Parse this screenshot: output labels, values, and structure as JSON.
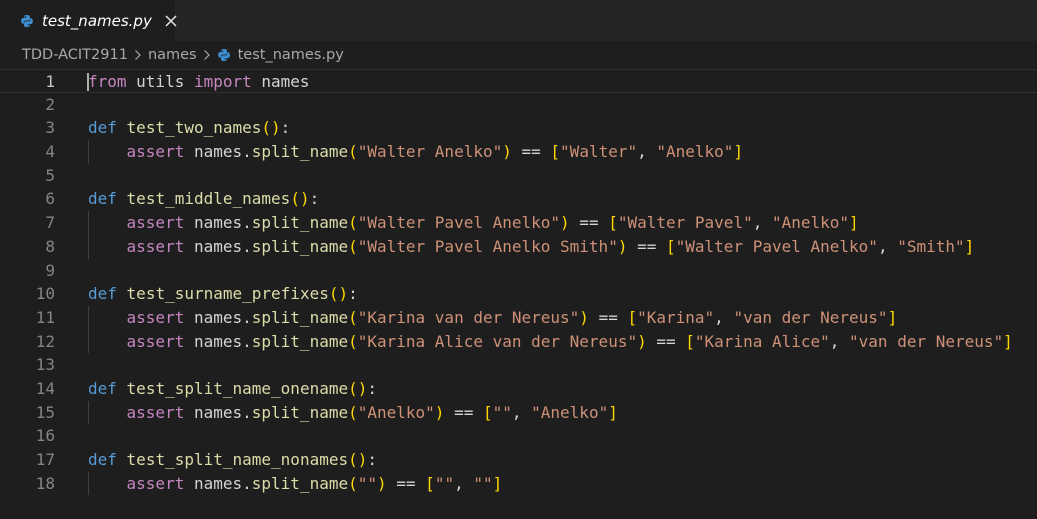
{
  "tab": {
    "title": "test_names.py",
    "close_glyph": "✕"
  },
  "breadcrumb": {
    "items": [
      "TDD-ACIT2911",
      "names",
      "test_names.py"
    ]
  },
  "colors": {
    "background": "#1e1e1e",
    "keyword_control": "#c586c0",
    "keyword_def": "#569cd6",
    "function": "#dcdcaa",
    "string": "#ce9178",
    "bracket_level1": "#ffd700",
    "bracket_level2": "#da70d6",
    "python_icon": "#3f8fd0"
  },
  "editor": {
    "active_line": 1,
    "lines": [
      {
        "num": "1",
        "tokens": [
          [
            "kw",
            "from"
          ],
          [
            "id",
            " utils "
          ],
          [
            "kw",
            "import"
          ],
          [
            "id",
            " names"
          ]
        ]
      },
      {
        "num": "2",
        "tokens": []
      },
      {
        "num": "3",
        "tokens": [
          [
            "def",
            "def"
          ],
          [
            "id",
            " "
          ],
          [
            "fn",
            "test_two_names"
          ],
          [
            "p1",
            "()"
          ],
          [
            "id",
            ":"
          ]
        ]
      },
      {
        "num": "4",
        "tokens": [
          [
            "id",
            "    "
          ],
          [
            "kw",
            "assert"
          ],
          [
            "id",
            " names."
          ],
          [
            "fn",
            "split_name"
          ],
          [
            "p1",
            "("
          ],
          [
            "str",
            "\"Walter Anelko\""
          ],
          [
            "p1",
            ")"
          ],
          [
            "id",
            " == "
          ],
          [
            "p1",
            "["
          ],
          [
            "str",
            "\"Walter\""
          ],
          [
            "id",
            ", "
          ],
          [
            "str",
            "\"Anelko\""
          ],
          [
            "p1",
            "]"
          ]
        ]
      },
      {
        "num": "5",
        "tokens": []
      },
      {
        "num": "6",
        "tokens": [
          [
            "def",
            "def"
          ],
          [
            "id",
            " "
          ],
          [
            "fn",
            "test_middle_names"
          ],
          [
            "p1",
            "()"
          ],
          [
            "id",
            ":"
          ]
        ]
      },
      {
        "num": "7",
        "tokens": [
          [
            "id",
            "    "
          ],
          [
            "kw",
            "assert"
          ],
          [
            "id",
            " names."
          ],
          [
            "fn",
            "split_name"
          ],
          [
            "p1",
            "("
          ],
          [
            "str",
            "\"Walter Pavel Anelko\""
          ],
          [
            "p1",
            ")"
          ],
          [
            "id",
            " == "
          ],
          [
            "p1",
            "["
          ],
          [
            "str",
            "\"Walter Pavel\""
          ],
          [
            "id",
            ", "
          ],
          [
            "str",
            "\"Anelko\""
          ],
          [
            "p1",
            "]"
          ]
        ]
      },
      {
        "num": "8",
        "tokens": [
          [
            "id",
            "    "
          ],
          [
            "kw",
            "assert"
          ],
          [
            "id",
            " names."
          ],
          [
            "fn",
            "split_name"
          ],
          [
            "p1",
            "("
          ],
          [
            "str",
            "\"Walter Pavel Anelko Smith\""
          ],
          [
            "p1",
            ")"
          ],
          [
            "id",
            " == "
          ],
          [
            "p1",
            "["
          ],
          [
            "str",
            "\"Walter Pavel Anelko\""
          ],
          [
            "id",
            ", "
          ],
          [
            "str",
            "\"Smith\""
          ],
          [
            "p1",
            "]"
          ]
        ]
      },
      {
        "num": "9",
        "tokens": []
      },
      {
        "num": "10",
        "tokens": [
          [
            "def",
            "def"
          ],
          [
            "id",
            " "
          ],
          [
            "fn",
            "test_surname_prefixes"
          ],
          [
            "p1",
            "()"
          ],
          [
            "id",
            ":"
          ]
        ]
      },
      {
        "num": "11",
        "tokens": [
          [
            "id",
            "    "
          ],
          [
            "kw",
            "assert"
          ],
          [
            "id",
            " names."
          ],
          [
            "fn",
            "split_name"
          ],
          [
            "p1",
            "("
          ],
          [
            "str",
            "\"Karina van der Nereus\""
          ],
          [
            "p1",
            ")"
          ],
          [
            "id",
            " == "
          ],
          [
            "p1",
            "["
          ],
          [
            "str",
            "\"Karina\""
          ],
          [
            "id",
            ", "
          ],
          [
            "str",
            "\"van der Nereus\""
          ],
          [
            "p1",
            "]"
          ]
        ]
      },
      {
        "num": "12",
        "tokens": [
          [
            "id",
            "    "
          ],
          [
            "kw",
            "assert"
          ],
          [
            "id",
            " names."
          ],
          [
            "fn",
            "split_name"
          ],
          [
            "p1",
            "("
          ],
          [
            "str",
            "\"Karina Alice van der Nereus\""
          ],
          [
            "p1",
            ")"
          ],
          [
            "id",
            " == "
          ],
          [
            "p1",
            "["
          ],
          [
            "str",
            "\"Karina Alice\""
          ],
          [
            "id",
            ", "
          ],
          [
            "str",
            "\"van der Nereus\""
          ],
          [
            "p1",
            "]"
          ]
        ]
      },
      {
        "num": "13",
        "tokens": []
      },
      {
        "num": "14",
        "tokens": [
          [
            "def",
            "def"
          ],
          [
            "id",
            " "
          ],
          [
            "fn",
            "test_split_name_onename"
          ],
          [
            "p1",
            "()"
          ],
          [
            "id",
            ":"
          ]
        ]
      },
      {
        "num": "15",
        "tokens": [
          [
            "id",
            "    "
          ],
          [
            "kw",
            "assert"
          ],
          [
            "id",
            " names."
          ],
          [
            "fn",
            "split_name"
          ],
          [
            "p1",
            "("
          ],
          [
            "str",
            "\"Anelko\""
          ],
          [
            "p1",
            ")"
          ],
          [
            "id",
            " == "
          ],
          [
            "p1",
            "["
          ],
          [
            "str",
            "\"\""
          ],
          [
            "id",
            ", "
          ],
          [
            "str",
            "\"Anelko\""
          ],
          [
            "p1",
            "]"
          ]
        ]
      },
      {
        "num": "16",
        "tokens": []
      },
      {
        "num": "17",
        "tokens": [
          [
            "def",
            "def"
          ],
          [
            "id",
            " "
          ],
          [
            "fn",
            "test_split_name_nonames"
          ],
          [
            "p1",
            "()"
          ],
          [
            "id",
            ":"
          ]
        ]
      },
      {
        "num": "18",
        "tokens": [
          [
            "id",
            "    "
          ],
          [
            "kw",
            "assert"
          ],
          [
            "id",
            " names."
          ],
          [
            "fn",
            "split_name"
          ],
          [
            "p1",
            "("
          ],
          [
            "str",
            "\"\""
          ],
          [
            "p1",
            ")"
          ],
          [
            "id",
            " == "
          ],
          [
            "p1",
            "["
          ],
          [
            "str",
            "\"\""
          ],
          [
            "id",
            ", "
          ],
          [
            "str",
            "\"\""
          ],
          [
            "p1",
            "]"
          ]
        ]
      }
    ]
  }
}
